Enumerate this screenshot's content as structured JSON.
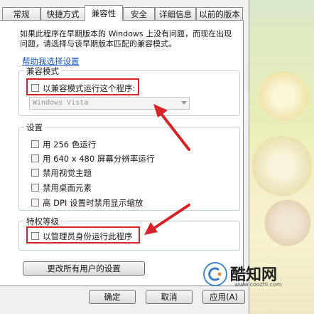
{
  "tabs": [
    {
      "label": "常规"
    },
    {
      "label": "快捷方式"
    },
    {
      "label": "兼容性",
      "active": true
    },
    {
      "label": "安全"
    },
    {
      "label": "详细信息"
    },
    {
      "label": "以前的版本"
    }
  ],
  "intro_text": "如果此程序在早期版本的 Windows 上没有问题，而现在出现问题，请选择与该早期版本匹配的兼容模式。",
  "help_link": "帮助我选择设置",
  "compat_group": {
    "title": "兼容模式",
    "checkbox_label": "以兼容模式运行这个程序:",
    "checked": false,
    "os_value": "Windows Vista"
  },
  "settings_group": {
    "title": "设置",
    "items": [
      {
        "label": "用 256 色运行",
        "checked": false
      },
      {
        "label": "用 640 x 480 屏幕分辨率运行",
        "checked": false
      },
      {
        "label": "禁用视觉主题",
        "checked": false
      },
      {
        "label": "禁用桌面元素",
        "checked": false
      },
      {
        "label": "高 DPI 设置时禁用显示缩放",
        "checked": false
      }
    ]
  },
  "privilege_group": {
    "title": "特权等级",
    "checkbox_label": "以管理员身份运行此程序",
    "checked": false
  },
  "all_users_button": "更改所有用户的设置",
  "buttons": {
    "ok": "确定",
    "cancel": "取消",
    "apply": "应用(A)"
  },
  "watermark": {
    "name": "酷知网",
    "url": "www.coozhi.com"
  },
  "colors": {
    "highlight_red": "#d7242b",
    "link_blue": "#1b55c4"
  }
}
